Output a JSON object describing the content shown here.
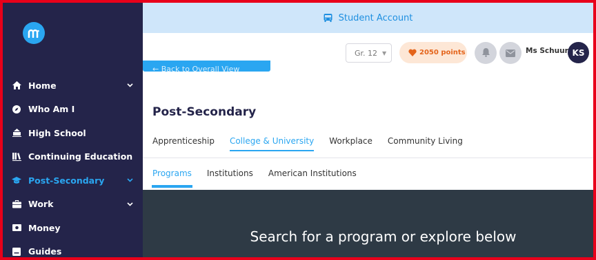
{
  "sidebar": {
    "logo_letter": "m",
    "items": [
      {
        "label": "Home",
        "icon": "home-icon",
        "has_chevron": true,
        "active": false
      },
      {
        "label": "Who Am I",
        "icon": "compass-icon",
        "has_chevron": false,
        "active": false
      },
      {
        "label": "High School",
        "icon": "school-icon",
        "has_chevron": false,
        "active": false
      },
      {
        "label": "Continuing Education",
        "icon": "library-icon",
        "has_chevron": false,
        "active": false
      },
      {
        "label": "Post-Secondary",
        "icon": "graduation-cap-icon",
        "has_chevron": true,
        "active": true
      },
      {
        "label": "Work",
        "icon": "briefcase-icon",
        "has_chevron": true,
        "active": false
      },
      {
        "label": "Money",
        "icon": "money-icon",
        "has_chevron": false,
        "active": false
      },
      {
        "label": "Guides",
        "icon": "guides-icon",
        "has_chevron": false,
        "active": false
      }
    ]
  },
  "banner": {
    "label": "Student Account",
    "icon": "bus-icon"
  },
  "topbar": {
    "grade": "Gr. 12",
    "points": "2050 points",
    "user_name": "Ms Schuur",
    "avatar_initials": "KS"
  },
  "back_button": {
    "label": "← Back to Overall View"
  },
  "page": {
    "title": "Post-Secondary",
    "primary_tabs": [
      "Apprenticeship",
      "College & University",
      "Workplace",
      "Community Living"
    ],
    "primary_active": "College & University",
    "secondary_tabs": [
      "Programs",
      "Institutions",
      "American Institutions"
    ],
    "secondary_active": "Programs"
  },
  "hero": {
    "text": "Search for a program or explore below"
  },
  "colors": {
    "sidebar": "#24244a",
    "accent": "#2aa6f1",
    "banner_bg": "#cfe6fa",
    "points_bg": "#fde7d6",
    "points_text": "#e4641b",
    "hero_bg": "#2e3a45",
    "frame_border": "#e8001a"
  }
}
